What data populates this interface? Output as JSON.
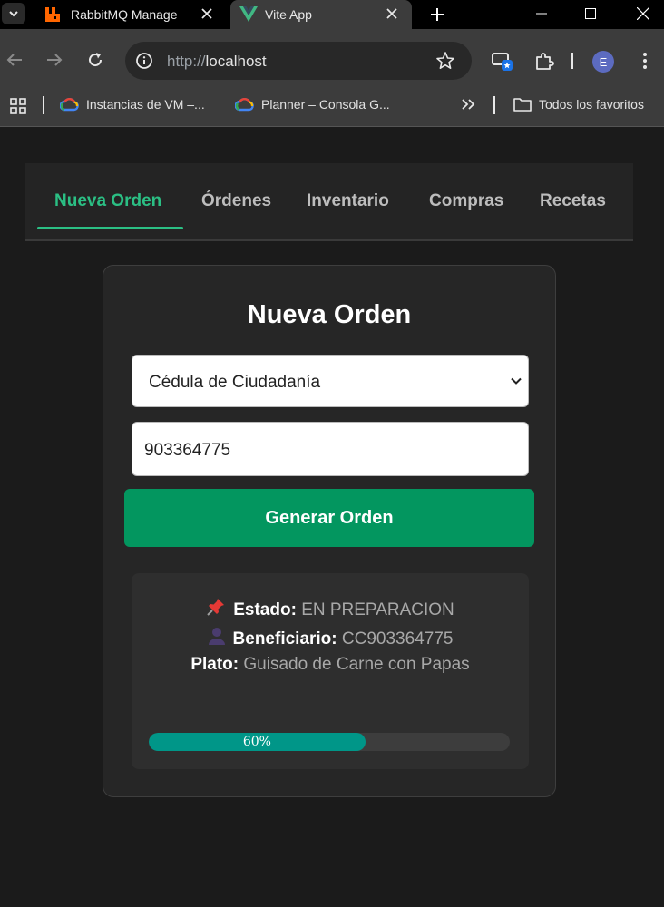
{
  "browser": {
    "tabs": [
      {
        "title": "RabbitMQ Manage",
        "active": false
      },
      {
        "title": "Vite App",
        "active": true
      }
    ],
    "address": {
      "scheme": "http://",
      "host": "localhost"
    },
    "profile_initial": "E",
    "bookmarks": [
      {
        "label": "Instancias de VM –..."
      },
      {
        "label": "Planner – Consola G..."
      }
    ],
    "all_bookmarks_label": "Todos los favoritos"
  },
  "nav": {
    "tabs": [
      {
        "label": "Nueva Orden",
        "active": true
      },
      {
        "label": "Órdenes",
        "active": false
      },
      {
        "label": "Inventario",
        "active": false
      },
      {
        "label": "Compras",
        "active": false
      },
      {
        "label": "Recetas",
        "active": false
      }
    ]
  },
  "form": {
    "title": "Nueva Orden",
    "doc_type": "Cédula de Ciudadanía",
    "doc_number": "903364775",
    "submit_label": "Generar Orden"
  },
  "order": {
    "estado_label": "Estado:",
    "estado_value": "EN PREPARACION",
    "beneficiario_label": "Beneficiario:",
    "beneficiario_value": "CC903364775",
    "plato_label": "Plato:",
    "plato_value": "Guisado de Carne con Papas",
    "progress_percent": 60,
    "progress_text": "60%"
  },
  "colors": {
    "accent": "#2bbf84",
    "button": "#03965f",
    "progress": "#009688"
  }
}
